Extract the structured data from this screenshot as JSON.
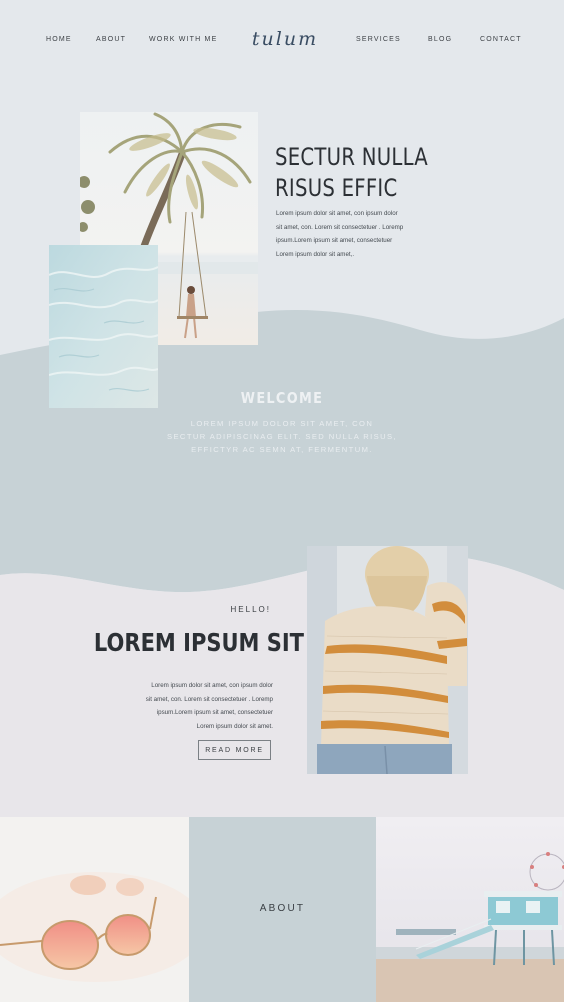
{
  "nav": {
    "left": [
      "HOME",
      "ABOUT",
      "WORK WITH ME"
    ],
    "logo": "tulum",
    "right": [
      "SERVICES",
      "BLOG",
      "CONTACT"
    ]
  },
  "hero": {
    "title_line1": "SECTUR NULLA",
    "title_line2": "RISUS EFFIC",
    "body": [
      "Lorem ipsum dolor sit amet, con  ipsum dolor",
      "sit amet, con. Lorem sit consectetuer . Loremp",
      "ipsum.Lorem ipsum sit amet, consectetuer",
      "Lorem ipsum dolor sit amet,."
    ]
  },
  "welcome": {
    "title": "WELCOME",
    "body": [
      "LOREM IPSUM DOLOR SIT AMET, CON",
      "SECTUR ADIPISCINAG ELIT. SED NULLA RISUS,",
      "EFFICTYR AC SEMN AT, FERMENTUM."
    ]
  },
  "intro": {
    "eyebrow": "HELLO!",
    "title": "LOREM IPSUM SIT",
    "body": [
      "Lorem ipsum dolor sit amet, con  ipsum dolor",
      "sit amet, con. Lorem sit consectetuer . Loremp",
      "ipsum.Lorem ipsum sit amet, consectetuer",
      "Lorem ipsum dolor sit amet."
    ],
    "button": "READ MORE"
  },
  "about": {
    "label": "ABOUT"
  },
  "colors": {
    "page_bg": "#e4e8ec",
    "wave_blue": "#c7d2d6",
    "lavender_bg": "#e7e5ea",
    "heading": "#2c3035",
    "logo": "#3a4d63"
  },
  "images": {
    "palm": "palm-tree-swing-photo",
    "water": "ocean-water-photo",
    "sweater": "woman-striped-sweater-photo",
    "sunglasses": "sunglasses-photo",
    "lifeguard": "lifeguard-tower-photo"
  }
}
